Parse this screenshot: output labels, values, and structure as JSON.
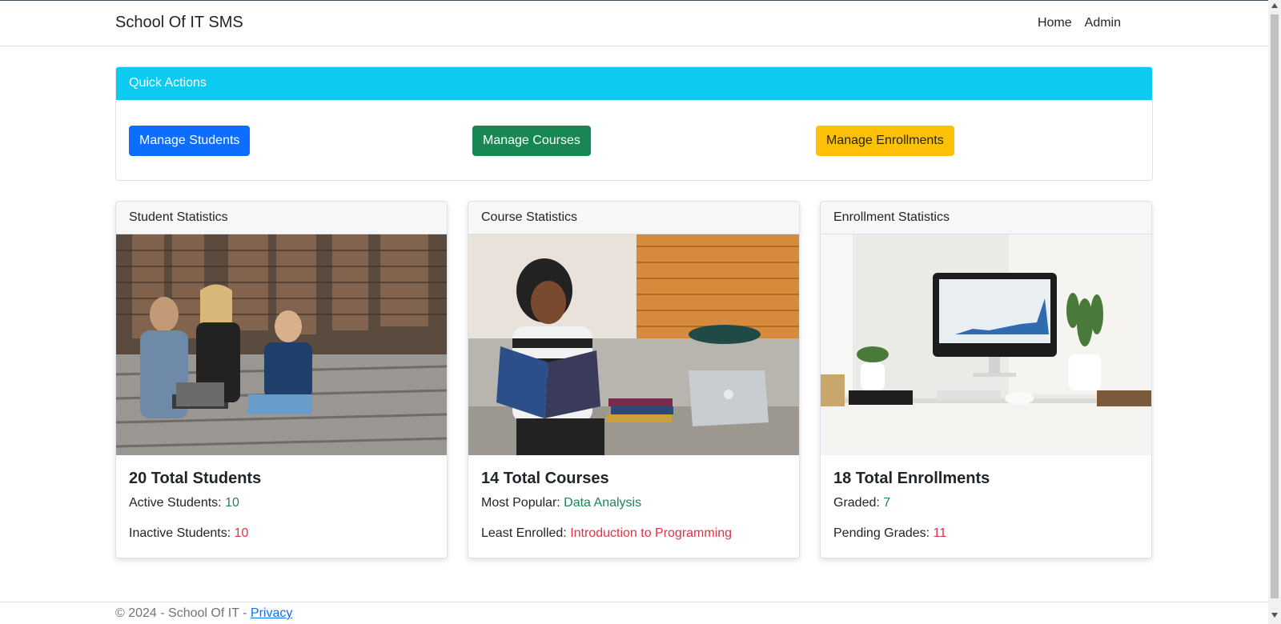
{
  "navbar": {
    "brand": "School Of IT SMS",
    "links": [
      "Home",
      "Admin"
    ]
  },
  "quick_actions": {
    "header": "Quick Actions",
    "buttons": {
      "students": "Manage Students",
      "courses": "Manage Courses",
      "enrollments": "Manage Enrollments"
    }
  },
  "cards": {
    "students": {
      "header": "Student Statistics",
      "title": "20 Total Students",
      "line1_label": "Active Students: ",
      "line1_value": "10",
      "line2_label": "Inactive Students: ",
      "line2_value": "10"
    },
    "courses": {
      "header": "Course Statistics",
      "title": "14 Total Courses",
      "line1_label": "Most Popular: ",
      "line1_value": "Data Analysis",
      "line2_label": "Least Enrolled: ",
      "line2_value": "Introduction to Programming"
    },
    "enrollments": {
      "header": "Enrollment Statistics",
      "title": "18 Total Enrollments",
      "line1_label": "Graded: ",
      "line1_value": "7",
      "line2_label": "Pending Grades: ",
      "line2_value": "11"
    }
  },
  "footer": {
    "text": "© 2024 - School Of IT - ",
    "link": "Privacy"
  },
  "colors": {
    "info": "#0dcaf0",
    "primary": "#0d6efd",
    "success": "#198754",
    "warning": "#ffc107",
    "danger": "#dc3545"
  }
}
